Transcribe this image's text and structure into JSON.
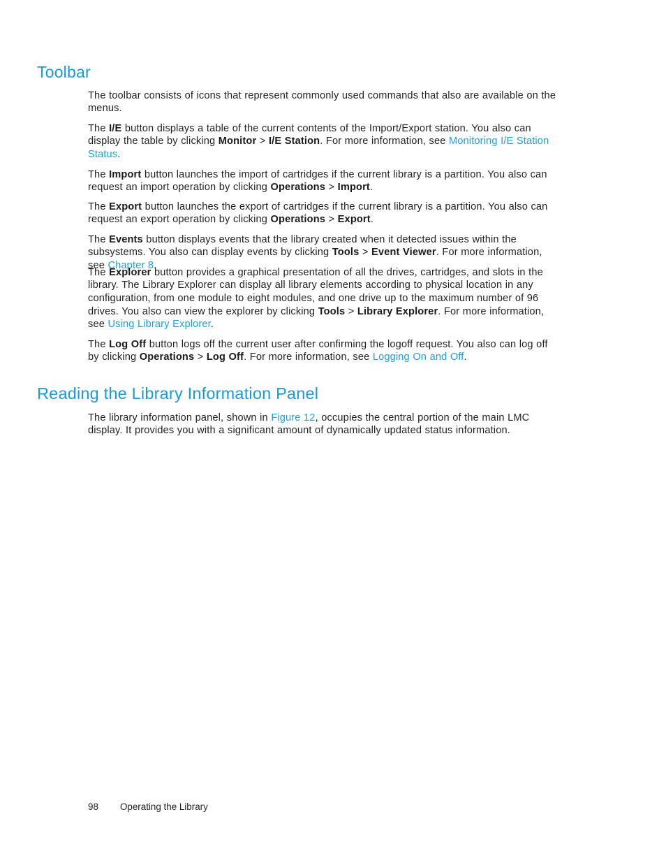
{
  "document": {
    "page_number": "98",
    "running_footer": "Operating the Library",
    "colors": {
      "heading": "#1a9ad7",
      "link": "#1f9fd8",
      "body_text": "#231f20",
      "background": "#ffffff"
    }
  },
  "sections": [
    {
      "id": "toolbar",
      "heading": "Toolbar",
      "paragraphs": [
        {
          "id": "intro",
          "runs": [
            {
              "t": "The toolbar consists of icons that represent commonly used commands that also are available on the menus.",
              "s": "normal"
            }
          ]
        },
        {
          "id": "ie",
          "runs": [
            {
              "t": "The ",
              "s": "normal"
            },
            {
              "t": "I/E",
              "s": "bold"
            },
            {
              "t": " button displays a table of the current contents of the Import/Export station. You also can display the table by clicking ",
              "s": "normal"
            },
            {
              "t": "Monitor",
              "s": "bold"
            },
            {
              "t": " > ",
              "s": "normal"
            },
            {
              "t": "I/E Station",
              "s": "bold"
            },
            {
              "t": ". For more information, see ",
              "s": "normal"
            },
            {
              "t": "Monitoring I/E Station Status",
              "s": "link"
            },
            {
              "t": ".",
              "s": "normal"
            }
          ]
        },
        {
          "id": "import",
          "runs": [
            {
              "t": "The ",
              "s": "normal"
            },
            {
              "t": "Import",
              "s": "bold"
            },
            {
              "t": " button launches the import of cartridges if the current library is a partition. You also can request an import operation by clicking ",
              "s": "normal"
            },
            {
              "t": "Operations",
              "s": "bold"
            },
            {
              "t": " > ",
              "s": "normal"
            },
            {
              "t": "Import",
              "s": "bold"
            },
            {
              "t": ".",
              "s": "normal"
            }
          ]
        },
        {
          "id": "export",
          "runs": [
            {
              "t": "The ",
              "s": "normal"
            },
            {
              "t": "Export",
              "s": "bold"
            },
            {
              "t": " button launches the export of cartridges if the current library is a partition. You also can request an export operation by clicking ",
              "s": "normal"
            },
            {
              "t": "Operations",
              "s": "bold"
            },
            {
              "t": " > ",
              "s": "normal"
            },
            {
              "t": "Export",
              "s": "bold"
            },
            {
              "t": ".",
              "s": "normal"
            }
          ]
        },
        {
          "id": "events",
          "runs": [
            {
              "t": "The ",
              "s": "normal"
            },
            {
              "t": "Events",
              "s": "bold"
            },
            {
              "t": " button displays events that the library created when it detected issues within the subsystems. You also can display events by clicking ",
              "s": "normal"
            },
            {
              "t": "Tools",
              "s": "bold"
            },
            {
              "t": " > ",
              "s": "normal"
            },
            {
              "t": "Event Viewer",
              "s": "bold"
            },
            {
              "t": ". For more information, see ",
              "s": "normal"
            },
            {
              "t": "Chapter 8",
              "s": "link"
            },
            {
              "t": ".",
              "s": "normal"
            }
          ]
        },
        {
          "id": "explorer",
          "runs": [
            {
              "t": "The ",
              "s": "normal"
            },
            {
              "t": "Explorer",
              "s": "bold"
            },
            {
              "t": " button provides a graphical presentation of all the drives, cartridges, and slots in the library. The Library Explorer can display all library elements according to physical location in any configuration, from one module to eight modules, and one drive up to the maximum number of 96 drives. You also can view the explorer by clicking ",
              "s": "normal"
            },
            {
              "t": "Tools",
              "s": "bold"
            },
            {
              "t": " > ",
              "s": "normal"
            },
            {
              "t": "Library Explorer",
              "s": "bold"
            },
            {
              "t": ". For more information, see ",
              "s": "normal"
            },
            {
              "t": "Using Library Explorer",
              "s": "link"
            },
            {
              "t": ".",
              "s": "normal"
            }
          ]
        },
        {
          "id": "logoff",
          "runs": [
            {
              "t": "The ",
              "s": "normal"
            },
            {
              "t": "Log Off",
              "s": "bold"
            },
            {
              "t": " button logs off the current user after confirming the logoff request. You also can log off by clicking ",
              "s": "normal"
            },
            {
              "t": "Operations",
              "s": "bold"
            },
            {
              "t": " > ",
              "s": "normal"
            },
            {
              "t": "Log Off",
              "s": "bold"
            },
            {
              "t": ". For more information, see ",
              "s": "normal"
            },
            {
              "t": "Logging On and Off",
              "s": "link"
            },
            {
              "t": ".",
              "s": "normal"
            }
          ]
        }
      ]
    },
    {
      "id": "reading-library-information-panel",
      "heading": "Reading the Library Information Panel",
      "paragraphs": [
        {
          "id": "readinfo",
          "runs": [
            {
              "t": "The library information panel, shown in ",
              "s": "normal"
            },
            {
              "t": "Figure 12",
              "s": "link"
            },
            {
              "t": ", occupies the central portion of the main LMC display. It provides you with a significant amount of dynamically updated status information.",
              "s": "normal"
            }
          ]
        }
      ]
    }
  ]
}
